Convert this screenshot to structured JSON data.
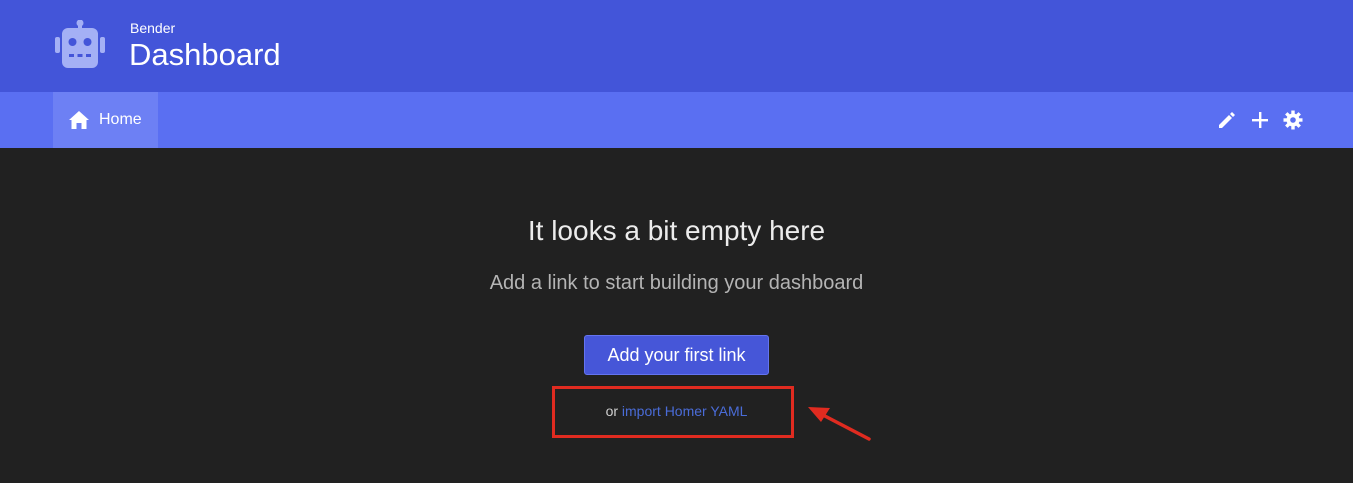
{
  "header": {
    "subtitle": "Bender",
    "title": "Dashboard",
    "logo_icon": "robot-icon"
  },
  "navbar": {
    "home_label": "Home",
    "home_icon": "home-icon",
    "actions": [
      {
        "name": "edit",
        "icon": "pencil-icon"
      },
      {
        "name": "add",
        "icon": "plus-icon"
      },
      {
        "name": "settings",
        "icon": "gear-icon"
      }
    ]
  },
  "main": {
    "empty_title": "It looks a bit empty here",
    "empty_subtitle": "Add a link to start building your dashboard",
    "add_button_label": "Add your first link",
    "import_prefix": "or",
    "import_link": "import Homer YAML"
  },
  "colors": {
    "header_bg": "#4355d9",
    "navbar_bg": "#5a6ff2",
    "nav_active_bg": "#6d80f4",
    "page_bg": "#212121",
    "button_bg": "#4656d8",
    "link": "#4a6cd8",
    "annotation": "#e02b20"
  }
}
